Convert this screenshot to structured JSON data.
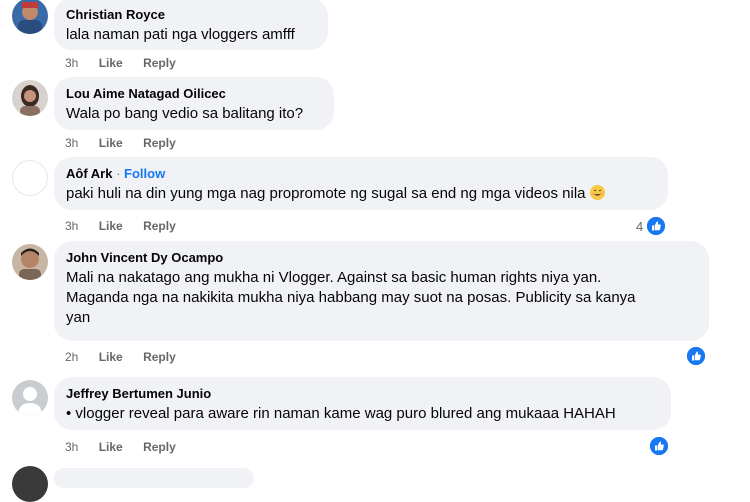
{
  "comments": [
    {
      "author": "Christian Royce",
      "text": "lala naman pati nga vloggers amfff",
      "time": "3h",
      "like": "Like",
      "reply": "Reply"
    },
    {
      "author": "Lou Aime Natagad Oilicec",
      "text": "Wala po bang vedio sa balitang ito?",
      "time": "3h",
      "like": "Like",
      "reply": "Reply"
    },
    {
      "author": "Aôf Ark",
      "follow": "Follow",
      "text": "paki huli na din yung mga nag propromote ng sugal sa end ng mga videos nila",
      "emoji": "smiling-face-emoji",
      "time": "3h",
      "like": "Like",
      "reply": "Reply",
      "reaction_count": "4",
      "reaction_icon": "like-reaction-icon"
    },
    {
      "author": "John Vincent Dy Ocampo",
      "text_lines": [
        "Mali na nakatago ang mukha ni Vlogger. Against sa basic human rights niya yan.",
        "Maganda nga na nakikita mukha niya habbang may suot na posas. Publicity sa kanya",
        "yan"
      ],
      "time": "2h",
      "like": "Like",
      "reply": "Reply",
      "reaction_icon": "like-reaction-icon"
    },
    {
      "author": "Jeffrey Bertumen Junio",
      "text": "• vlogger reveal para aware rin naman kame wag puro blured ang mukaaa HAHAH",
      "time": "3h",
      "like": "Like",
      "reply": "Reply",
      "reaction_icon": "like-reaction-icon"
    }
  ],
  "colors": {
    "bubble": "#f0f2f5",
    "meta": "#65676b",
    "accent": "#1877f2",
    "text": "#050505"
  }
}
